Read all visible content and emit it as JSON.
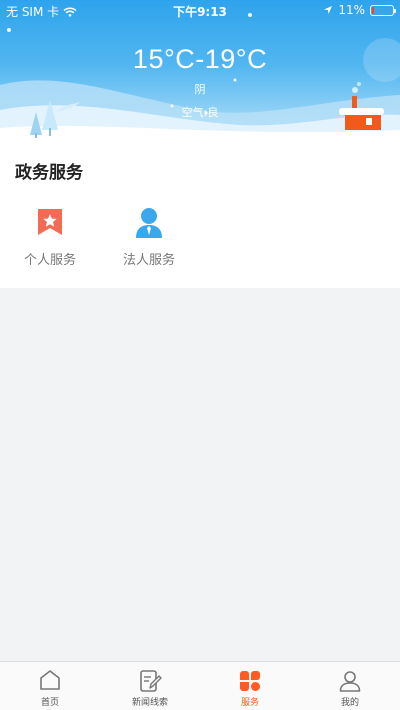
{
  "status_bar": {
    "carrier": "无 SIM 卡",
    "time": "下午9:13",
    "battery": "11%",
    "battery_level": 0.11
  },
  "weather": {
    "temperature_range": "15°C-19°C",
    "condition": "阴",
    "air_quality": "空气:良"
  },
  "services": {
    "title": "政务服务",
    "items": [
      {
        "label": "个人服务",
        "icon": "bookmark-star-icon",
        "color": "#f26b54"
      },
      {
        "label": "法人服务",
        "icon": "person-tie-icon",
        "color": "#3aa8ec"
      }
    ]
  },
  "tabbar": {
    "active_color": "#ff5a1f",
    "items": [
      {
        "label": "首页",
        "icon": "home-icon",
        "active": false
      },
      {
        "label": "新闻线索",
        "icon": "news-edit-icon",
        "active": false
      },
      {
        "label": "服务",
        "icon": "services-grid-icon",
        "active": true
      },
      {
        "label": "我的",
        "icon": "user-icon",
        "active": false
      }
    ]
  }
}
